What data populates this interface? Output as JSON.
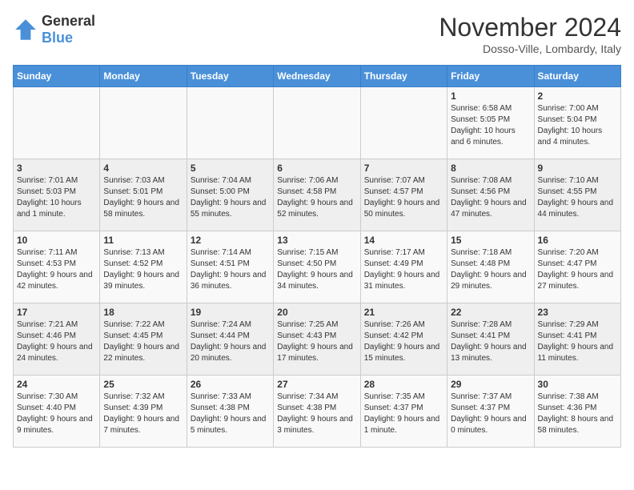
{
  "header": {
    "logo_general": "General",
    "logo_blue": "Blue",
    "month_title": "November 2024",
    "subtitle": "Dosso-Ville, Lombardy, Italy"
  },
  "days_of_week": [
    "Sunday",
    "Monday",
    "Tuesday",
    "Wednesday",
    "Thursday",
    "Friday",
    "Saturday"
  ],
  "weeks": [
    [
      {
        "day": "",
        "info": ""
      },
      {
        "day": "",
        "info": ""
      },
      {
        "day": "",
        "info": ""
      },
      {
        "day": "",
        "info": ""
      },
      {
        "day": "",
        "info": ""
      },
      {
        "day": "1",
        "info": "Sunrise: 6:58 AM\nSunset: 5:05 PM\nDaylight: 10 hours and 6 minutes."
      },
      {
        "day": "2",
        "info": "Sunrise: 7:00 AM\nSunset: 5:04 PM\nDaylight: 10 hours and 4 minutes."
      }
    ],
    [
      {
        "day": "3",
        "info": "Sunrise: 7:01 AM\nSunset: 5:03 PM\nDaylight: 10 hours and 1 minute."
      },
      {
        "day": "4",
        "info": "Sunrise: 7:03 AM\nSunset: 5:01 PM\nDaylight: 9 hours and 58 minutes."
      },
      {
        "day": "5",
        "info": "Sunrise: 7:04 AM\nSunset: 5:00 PM\nDaylight: 9 hours and 55 minutes."
      },
      {
        "day": "6",
        "info": "Sunrise: 7:06 AM\nSunset: 4:58 PM\nDaylight: 9 hours and 52 minutes."
      },
      {
        "day": "7",
        "info": "Sunrise: 7:07 AM\nSunset: 4:57 PM\nDaylight: 9 hours and 50 minutes."
      },
      {
        "day": "8",
        "info": "Sunrise: 7:08 AM\nSunset: 4:56 PM\nDaylight: 9 hours and 47 minutes."
      },
      {
        "day": "9",
        "info": "Sunrise: 7:10 AM\nSunset: 4:55 PM\nDaylight: 9 hours and 44 minutes."
      }
    ],
    [
      {
        "day": "10",
        "info": "Sunrise: 7:11 AM\nSunset: 4:53 PM\nDaylight: 9 hours and 42 minutes."
      },
      {
        "day": "11",
        "info": "Sunrise: 7:13 AM\nSunset: 4:52 PM\nDaylight: 9 hours and 39 minutes."
      },
      {
        "day": "12",
        "info": "Sunrise: 7:14 AM\nSunset: 4:51 PM\nDaylight: 9 hours and 36 minutes."
      },
      {
        "day": "13",
        "info": "Sunrise: 7:15 AM\nSunset: 4:50 PM\nDaylight: 9 hours and 34 minutes."
      },
      {
        "day": "14",
        "info": "Sunrise: 7:17 AM\nSunset: 4:49 PM\nDaylight: 9 hours and 31 minutes."
      },
      {
        "day": "15",
        "info": "Sunrise: 7:18 AM\nSunset: 4:48 PM\nDaylight: 9 hours and 29 minutes."
      },
      {
        "day": "16",
        "info": "Sunrise: 7:20 AM\nSunset: 4:47 PM\nDaylight: 9 hours and 27 minutes."
      }
    ],
    [
      {
        "day": "17",
        "info": "Sunrise: 7:21 AM\nSunset: 4:46 PM\nDaylight: 9 hours and 24 minutes."
      },
      {
        "day": "18",
        "info": "Sunrise: 7:22 AM\nSunset: 4:45 PM\nDaylight: 9 hours and 22 minutes."
      },
      {
        "day": "19",
        "info": "Sunrise: 7:24 AM\nSunset: 4:44 PM\nDaylight: 9 hours and 20 minutes."
      },
      {
        "day": "20",
        "info": "Sunrise: 7:25 AM\nSunset: 4:43 PM\nDaylight: 9 hours and 17 minutes."
      },
      {
        "day": "21",
        "info": "Sunrise: 7:26 AM\nSunset: 4:42 PM\nDaylight: 9 hours and 15 minutes."
      },
      {
        "day": "22",
        "info": "Sunrise: 7:28 AM\nSunset: 4:41 PM\nDaylight: 9 hours and 13 minutes."
      },
      {
        "day": "23",
        "info": "Sunrise: 7:29 AM\nSunset: 4:41 PM\nDaylight: 9 hours and 11 minutes."
      }
    ],
    [
      {
        "day": "24",
        "info": "Sunrise: 7:30 AM\nSunset: 4:40 PM\nDaylight: 9 hours and 9 minutes."
      },
      {
        "day": "25",
        "info": "Sunrise: 7:32 AM\nSunset: 4:39 PM\nDaylight: 9 hours and 7 minutes."
      },
      {
        "day": "26",
        "info": "Sunrise: 7:33 AM\nSunset: 4:38 PM\nDaylight: 9 hours and 5 minutes."
      },
      {
        "day": "27",
        "info": "Sunrise: 7:34 AM\nSunset: 4:38 PM\nDaylight: 9 hours and 3 minutes."
      },
      {
        "day": "28",
        "info": "Sunrise: 7:35 AM\nSunset: 4:37 PM\nDaylight: 9 hours and 1 minute."
      },
      {
        "day": "29",
        "info": "Sunrise: 7:37 AM\nSunset: 4:37 PM\nDaylight: 9 hours and 0 minutes."
      },
      {
        "day": "30",
        "info": "Sunrise: 7:38 AM\nSunset: 4:36 PM\nDaylight: 8 hours and 58 minutes."
      }
    ]
  ]
}
